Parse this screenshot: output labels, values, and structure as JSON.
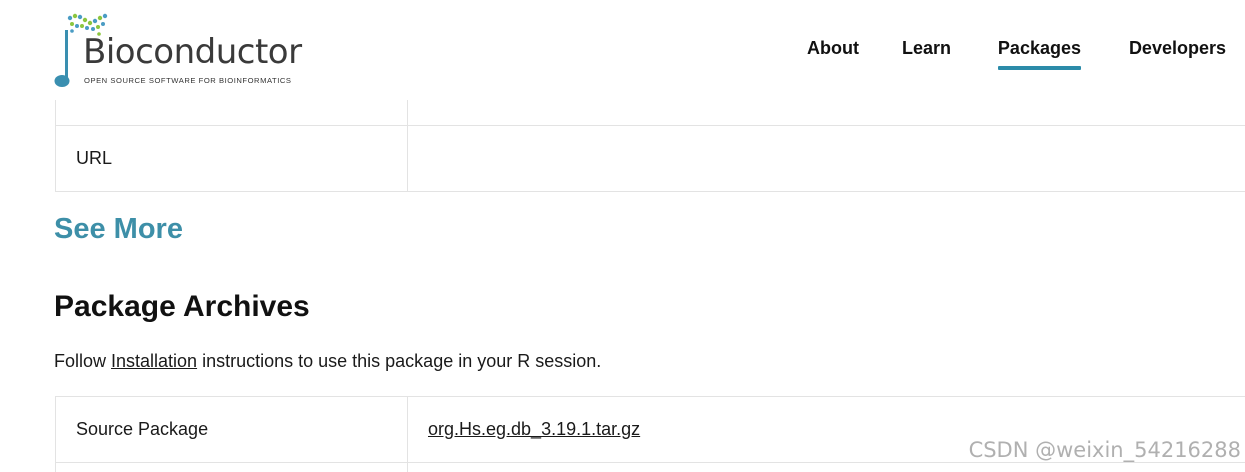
{
  "header": {
    "logo_name": "Bioconductor",
    "logo_tagline": "OPEN SOURCE SOFTWARE FOR BIOINFORMATICS",
    "nav": [
      {
        "label": "About"
      },
      {
        "label": "Learn"
      },
      {
        "label": "Packages"
      },
      {
        "label": "Developers"
      }
    ],
    "active_nav": "Packages",
    "accent_color": "#2b8ba9"
  },
  "details_table": {
    "rows": [
      {
        "label": "",
        "value": ""
      },
      {
        "label": "URL",
        "value": ""
      }
    ]
  },
  "see_more": "See More",
  "archives": {
    "title": "Package Archives",
    "intro_before": "Follow ",
    "intro_link": "Installation",
    "intro_after": " instructions to use this package in your R session.",
    "rows": [
      {
        "label": "Source Package",
        "value": "org.Hs.eg.db_3.19.1.tar.gz"
      }
    ]
  },
  "watermark": "CSDN @weixin_54216288",
  "colors": {
    "link_teal": "#3d8fa8",
    "border": "#e3e3e3"
  }
}
